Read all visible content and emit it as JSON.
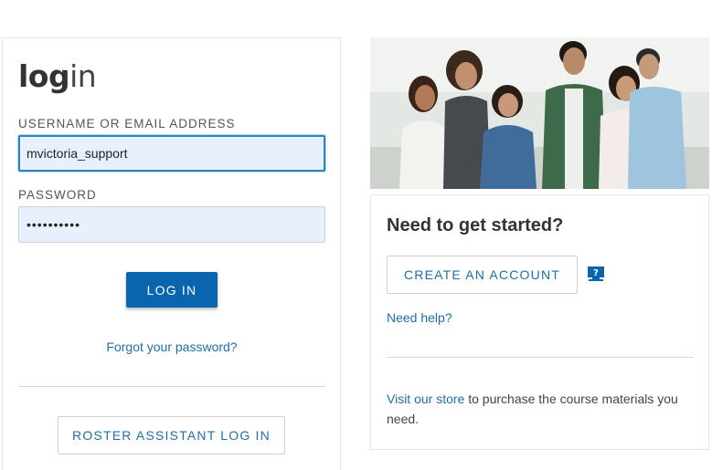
{
  "login": {
    "title_bold": "log",
    "title_light": "in",
    "username_label": "USERNAME OR EMAIL ADDRESS",
    "username_value": "mvictoria_support",
    "password_label": "PASSWORD",
    "password_value": "••••••••••",
    "login_button": "LOG IN",
    "forgot_link": "Forgot your password?",
    "roster_button": "ROSTER ASSISTANT LOG IN"
  },
  "hero": {
    "icon": "students-photo"
  },
  "get_started": {
    "title": "Need to get started?",
    "create_button": "CREATE AN ACCOUNT",
    "help_icon": "question-icon",
    "need_help_link": "Need help?",
    "store_link": "Visit our store",
    "store_text": " to purchase the course materials you need."
  },
  "colors": {
    "primary": "#0b65ae",
    "link": "#1e6fa8",
    "input_bg": "#e8f0fe",
    "focus_border": "#2a86b8"
  }
}
